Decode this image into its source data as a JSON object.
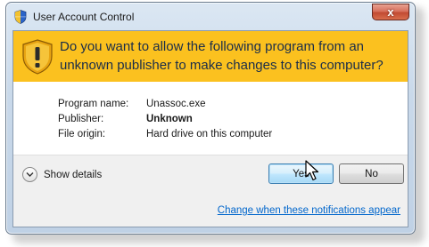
{
  "window": {
    "title": "User Account Control",
    "close_glyph": "x",
    "title_icon": "shield-icon"
  },
  "banner": {
    "question": "Do you want to allow the following program from an unknown publisher to make changes to this computer?",
    "icon": "warning-shield-icon",
    "color": "#fbc11f"
  },
  "details": [
    {
      "label": "Program name:",
      "value": "Unassoc.exe",
      "bold": false
    },
    {
      "label": "Publisher:",
      "value": "Unknown",
      "bold": true
    },
    {
      "label": "File origin:",
      "value": "Hard drive on this computer",
      "bold": false
    }
  ],
  "footer": {
    "show_details_label": "Show details",
    "yes_label": "Yes",
    "no_label": "No",
    "link_text": "Change when these notifications appear",
    "link_color": "#0066cc"
  }
}
